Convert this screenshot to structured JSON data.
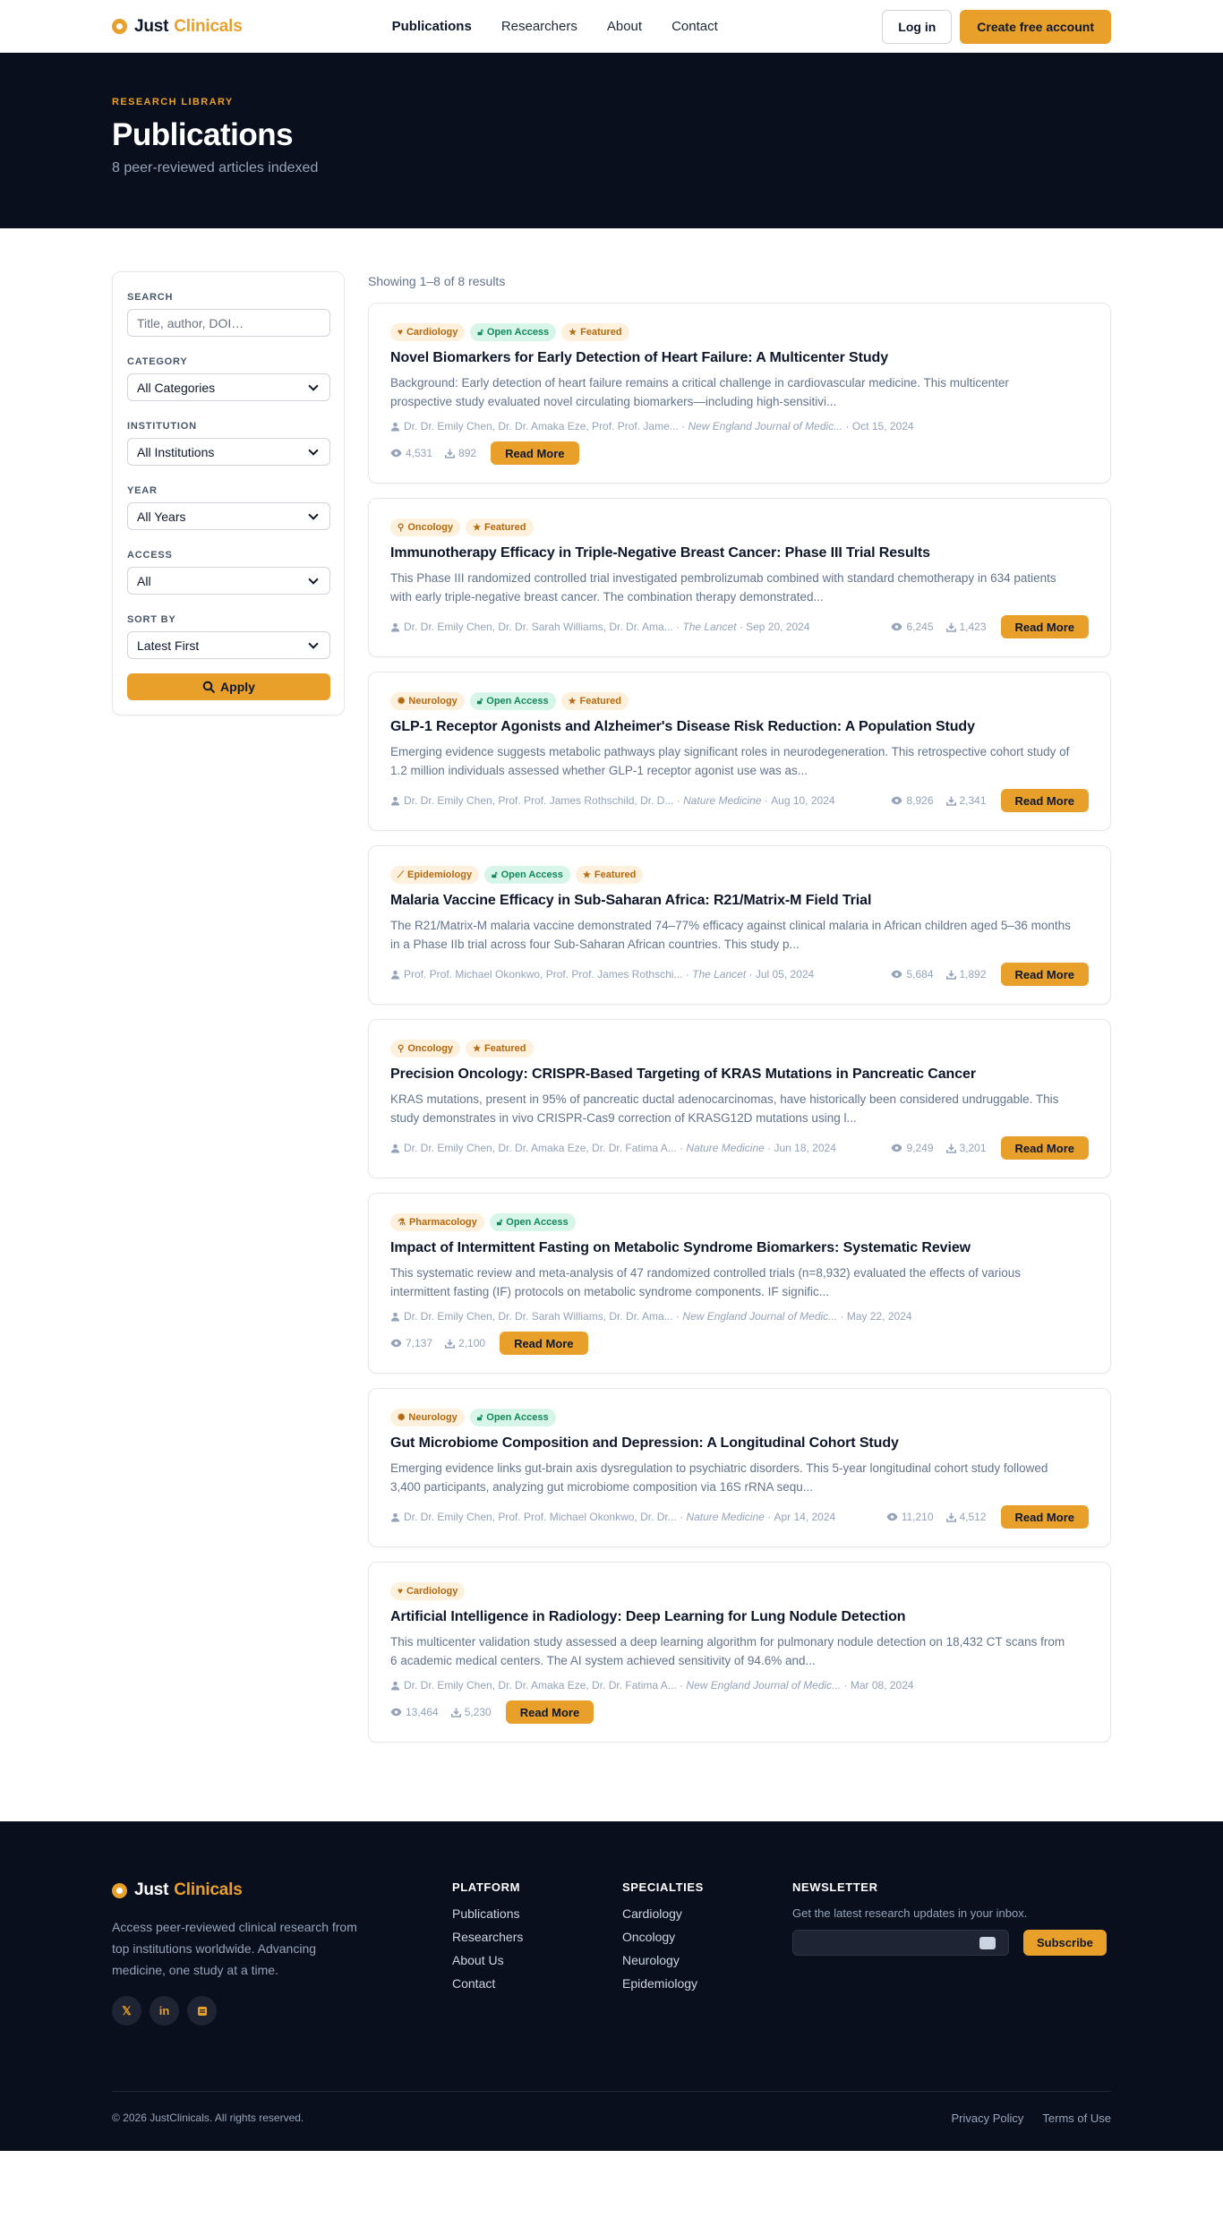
{
  "header": {
    "brand_first": "Just",
    "brand_second": "Clinicals",
    "nav": [
      {
        "label": "Publications"
      },
      {
        "label": "Researchers"
      },
      {
        "label": "About"
      },
      {
        "label": "Contact"
      }
    ],
    "login_label": "Log in",
    "create_label": "Create free account"
  },
  "hero": {
    "eyebrow": "RESEARCH LIBRARY",
    "title": "Publications",
    "subtitle": "8 peer-reviewed articles indexed"
  },
  "filters": {
    "search_label": "SEARCH",
    "search_placeholder": "Title, author, DOI…",
    "category_label": "CATEGORY",
    "category_value": "All Categories",
    "institution_label": "INSTITUTION",
    "institution_value": "All Institutions",
    "year_label": "YEAR",
    "year_value": "All Years",
    "access_label": "ACCESS",
    "access_value": "All",
    "sort_label": "SORT BY",
    "sort_value": "Latest First",
    "apply_label": "Apply"
  },
  "results": {
    "showing": "Showing 1–8 of 8 results",
    "read_label": "Read More",
    "articles": [
      {
        "category": "Cardiology",
        "open_access": "Open Access",
        "featured": "Featured",
        "title": "Novel Biomarkers for Early Detection of Heart Failure: A Multicenter Study",
        "abstract": "Background: Early detection of heart failure remains a critical challenge in cardiovascular medicine. This multicenter prospective study evaluated novel circulating biomarkers—including high-sensitivi...",
        "authors": "Dr. Dr. Emily Chen, Dr. Dr. Amaka Eze, Prof. Prof. Jame...",
        "journal": "New England Journal of Medic...",
        "date": "Oct 15, 2024",
        "views": "4,531",
        "downloads": "892"
      },
      {
        "category": "Oncology",
        "open_access": "",
        "featured": "Featured",
        "title": "Immunotherapy Efficacy in Triple-Negative Breast Cancer: Phase III Trial Results",
        "abstract": "This Phase III randomized controlled trial investigated pembrolizumab combined with standard chemotherapy in 634 patients with early triple-negative breast cancer. The combination therapy demonstrated...",
        "authors": "Dr. Dr. Emily Chen, Dr. Dr. Sarah Williams, Dr. Dr. Ama...",
        "journal": "The Lancet",
        "date": "Sep 20, 2024",
        "views": "6,245",
        "downloads": "1,423"
      },
      {
        "category": "Neurology",
        "open_access": "Open Access",
        "featured": "Featured",
        "title": "GLP-1 Receptor Agonists and Alzheimer's Disease Risk Reduction: A Population Study",
        "abstract": "Emerging evidence suggests metabolic pathways play significant roles in neurodegeneration. This retrospective cohort study of 1.2 million individuals assessed whether GLP-1 receptor agonist use was as...",
        "authors": "Dr. Dr. Emily Chen, Prof. Prof. James Rothschild, Dr. D...",
        "journal": "Nature Medicine",
        "date": "Aug 10, 2024",
        "views": "8,926",
        "downloads": "2,341"
      },
      {
        "category": "Epidemiology",
        "open_access": "Open Access",
        "featured": "Featured",
        "title": "Malaria Vaccine Efficacy in Sub-Saharan Africa: R21/Matrix-M Field Trial",
        "abstract": "The R21/Matrix-M malaria vaccine demonstrated 74–77% efficacy against clinical malaria in African children aged 5–36 months in a Phase IIb trial across four Sub-Saharan African countries. This study p...",
        "authors": "Prof. Prof. Michael Okonkwo, Prof. Prof. James Rothschi...",
        "journal": "The Lancet",
        "date": "Jul 05, 2024",
        "views": "5,684",
        "downloads": "1,892"
      },
      {
        "category": "Oncology",
        "open_access": "",
        "featured": "Featured",
        "title": "Precision Oncology: CRISPR-Based Targeting of KRAS Mutations in Pancreatic Cancer",
        "abstract": "KRAS mutations, present in 95% of pancreatic ductal adenocarcinomas, have historically been considered undruggable. This study demonstrates in vivo CRISPR-Cas9 correction of KRASG12D mutations using l...",
        "authors": "Dr. Dr. Emily Chen, Dr. Dr. Amaka Eze, Dr. Dr. Fatima A...",
        "journal": "Nature Medicine",
        "date": "Jun 18, 2024",
        "views": "9,249",
        "downloads": "3,201"
      },
      {
        "category": "Pharmacology",
        "open_access": "Open Access",
        "featured": "",
        "title": "Impact of Intermittent Fasting on Metabolic Syndrome Biomarkers: Systematic Review",
        "abstract": "This systematic review and meta-analysis of 47 randomized controlled trials (n=8,932) evaluated the effects of various intermittent fasting (IF) protocols on metabolic syndrome components. IF signific...",
        "authors": "Dr. Dr. Emily Chen, Dr. Dr. Sarah Williams, Dr. Dr. Ama...",
        "journal": "New England Journal of Medic...",
        "date": "May 22, 2024",
        "views": "7,137",
        "downloads": "2,100"
      },
      {
        "category": "Neurology",
        "open_access": "Open Access",
        "featured": "",
        "title": "Gut Microbiome Composition and Depression: A Longitudinal Cohort Study",
        "abstract": "Emerging evidence links gut-brain axis dysregulation to psychiatric disorders. This 5-year longitudinal cohort study followed 3,400 participants, analyzing gut microbiome composition via 16S rRNA sequ...",
        "authors": "Dr. Dr. Emily Chen, Prof. Prof. Michael Okonkwo, Dr. Dr...",
        "journal": "Nature Medicine",
        "date": "Apr 14, 2024",
        "views": "11,210",
        "downloads": "4,512"
      },
      {
        "category": "Cardiology",
        "open_access": "",
        "featured": "",
        "title": "Artificial Intelligence in Radiology: Deep Learning for Lung Nodule Detection",
        "abstract": "This multicenter validation study assessed a deep learning algorithm for pulmonary nodule detection on 18,432 CT scans from 6 academic medical centers. The AI system achieved sensitivity of 94.6% and...",
        "authors": "Dr. Dr. Emily Chen, Dr. Dr. Amaka Eze, Dr. Dr. Fatima A...",
        "journal": "New England Journal of Medic...",
        "date": "Mar 08, 2024",
        "views": "13,464",
        "downloads": "5,230"
      }
    ]
  },
  "footer": {
    "brand_first": "Just",
    "brand_second": "Clinicals",
    "description": "Access peer-reviewed clinical research from top institutions worldwide. Advancing medicine, one study at a time.",
    "social_icons": [
      "x-icon",
      "linkedin-icon",
      "rss-icon"
    ],
    "platform_title": "PLATFORM",
    "platform_links": [
      "Publications",
      "Researchers",
      "About Us",
      "Contact"
    ],
    "specialties_title": "SPECIALTIES",
    "specialties_links": [
      "Cardiology",
      "Oncology",
      "Neurology",
      "Epidemiology"
    ],
    "newsletter_title": "NEWSLETTER",
    "newsletter_text": "Get the latest research updates in your inbox.",
    "subscribe_label": "Subscribe",
    "copyright": "© 2026 JustClinicals. All rights reserved.",
    "privacy_label": "Privacy Policy",
    "terms_label": "Terms of Use"
  },
  "colors": {
    "accent": "#e9a02a",
    "dark_bg": "#0a0f1e",
    "open_access_green": "#0f8a5a"
  }
}
